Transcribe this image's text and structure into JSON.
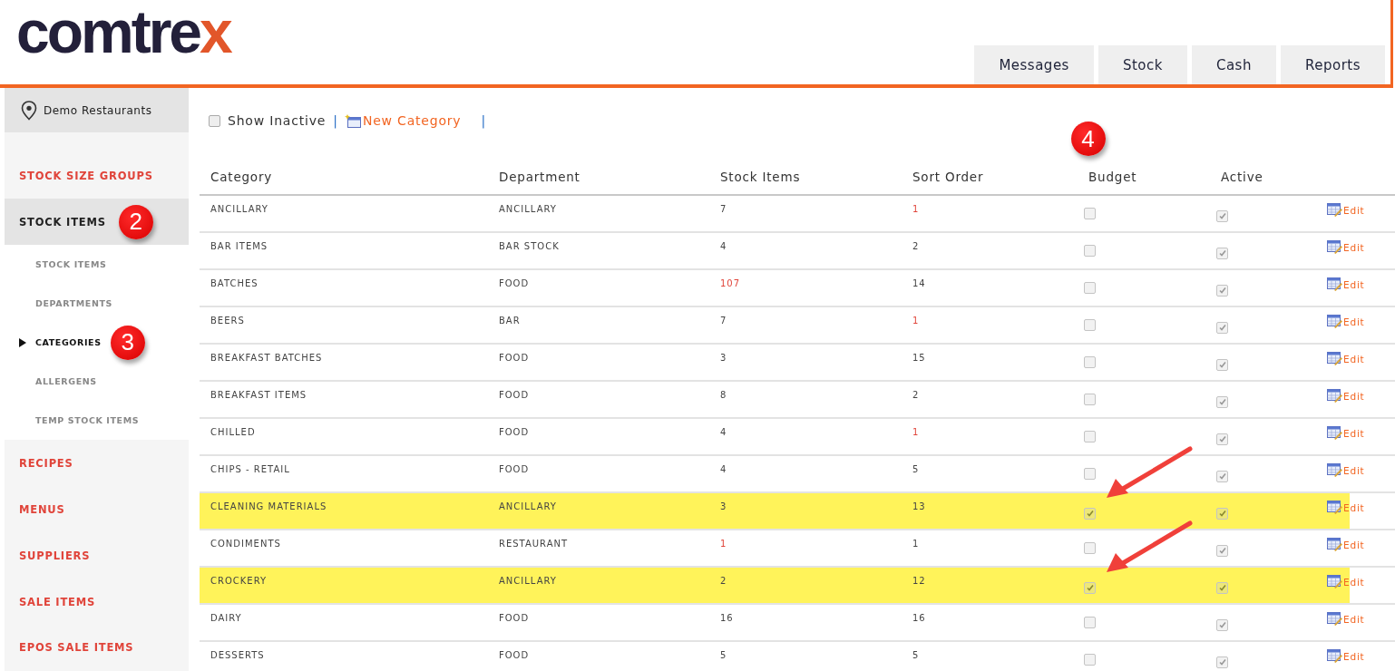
{
  "logo": {
    "text": "comtre",
    "accent": "x"
  },
  "nav_tabs": [
    {
      "label": "Messages",
      "selected": false
    },
    {
      "label": "Stock",
      "selected": false
    },
    {
      "label": "Cash",
      "selected": false
    },
    {
      "label": "Reports",
      "selected": false
    }
  ],
  "location": "Demo Restaurants",
  "sidebar": {
    "items": [
      {
        "label": "STOCK SIZE GROUPS",
        "selected": false
      },
      {
        "label": "STOCK ITEMS",
        "selected": true,
        "badge": "2",
        "children": [
          {
            "label": "STOCK ITEMS",
            "selected": false
          },
          {
            "label": "DEPARTMENTS",
            "selected": false
          },
          {
            "label": "CATEGORIES",
            "selected": true,
            "badge": "3"
          },
          {
            "label": "ALLERGENS",
            "selected": false
          },
          {
            "label": "TEMP STOCK ITEMS",
            "selected": false
          }
        ]
      },
      {
        "label": "RECIPES",
        "selected": false
      },
      {
        "label": "MENUS",
        "selected": false
      },
      {
        "label": "SUPPLIERS",
        "selected": false
      },
      {
        "label": "SALE ITEMS",
        "selected": false
      },
      {
        "label": "EPOS SALE ITEMS",
        "selected": false
      }
    ]
  },
  "toolbar": {
    "show_inactive": {
      "label": "Show Inactive",
      "checked": false
    },
    "separator": "|",
    "new_button": "New Category",
    "separator_2": "|"
  },
  "table": {
    "columns": [
      {
        "label": "Category"
      },
      {
        "label": "Department"
      },
      {
        "label": "Stock Items"
      },
      {
        "label": "Sort Order"
      },
      {
        "label": "Budget",
        "badge": "4"
      },
      {
        "label": "Active"
      }
    ],
    "rows": [
      {
        "category": "ANCILLARY",
        "department": "ANCILLARY",
        "stock_items": {
          "text": "7",
          "link": false
        },
        "sort_order": {
          "text": "1",
          "link": true
        },
        "budget": false,
        "active": true,
        "highlighted": false,
        "arrow": false,
        "edit": "Edit"
      },
      {
        "category": "BAR ITEMS",
        "department": "BAR STOCK",
        "stock_items": {
          "text": "4",
          "link": false
        },
        "sort_order": {
          "text": "2",
          "link": false
        },
        "budget": false,
        "active": true,
        "highlighted": false,
        "arrow": false,
        "edit": "Edit"
      },
      {
        "category": "BATCHES",
        "department": "FOOD",
        "stock_items": {
          "text": "107",
          "link": true
        },
        "sort_order": {
          "text": "14",
          "link": false
        },
        "budget": false,
        "active": true,
        "highlighted": false,
        "arrow": false,
        "edit": "Edit"
      },
      {
        "category": "BEERS",
        "department": "BAR",
        "stock_items": {
          "text": "7",
          "link": false
        },
        "sort_order": {
          "text": "1",
          "link": true
        },
        "budget": false,
        "active": true,
        "highlighted": false,
        "arrow": false,
        "edit": "Edit"
      },
      {
        "category": "BREAKFAST BATCHES",
        "department": "FOOD",
        "stock_items": {
          "text": "3",
          "link": false
        },
        "sort_order": {
          "text": "15",
          "link": false
        },
        "budget": false,
        "active": true,
        "highlighted": false,
        "arrow": false,
        "edit": "Edit"
      },
      {
        "category": "BREAKFAST ITEMS",
        "department": "FOOD",
        "stock_items": {
          "text": "8",
          "link": false
        },
        "sort_order": {
          "text": "2",
          "link": false
        },
        "budget": false,
        "active": true,
        "highlighted": false,
        "arrow": false,
        "edit": "Edit"
      },
      {
        "category": "CHILLED",
        "department": "FOOD",
        "stock_items": {
          "text": "4",
          "link": false
        },
        "sort_order": {
          "text": "1",
          "link": true
        },
        "budget": false,
        "active": true,
        "highlighted": false,
        "arrow": false,
        "edit": "Edit"
      },
      {
        "category": "CHIPS - RETAIL",
        "department": "FOOD",
        "stock_items": {
          "text": "4",
          "link": false
        },
        "sort_order": {
          "text": "5",
          "link": false
        },
        "budget": false,
        "active": true,
        "highlighted": false,
        "arrow": false,
        "edit": "Edit"
      },
      {
        "category": "CLEANING MATERIALS",
        "department": "ANCILLARY",
        "stock_items": {
          "text": "3",
          "link": false
        },
        "sort_order": {
          "text": "13",
          "link": false
        },
        "budget": true,
        "active": true,
        "highlighted": true,
        "arrow": true,
        "edit": "Edit"
      },
      {
        "category": "CONDIMENTS",
        "department": "RESTAURANT",
        "stock_items": {
          "text": "1",
          "link": true
        },
        "sort_order": {
          "text": "1",
          "link": false
        },
        "budget": false,
        "active": true,
        "highlighted": false,
        "arrow": false,
        "edit": "Edit"
      },
      {
        "category": "CROCKERY",
        "department": "ANCILLARY",
        "stock_items": {
          "text": "2",
          "link": false
        },
        "sort_order": {
          "text": "12",
          "link": false
        },
        "budget": true,
        "active": true,
        "highlighted": true,
        "arrow": true,
        "edit": "Edit"
      },
      {
        "category": "DAIRY",
        "department": "FOOD",
        "stock_items": {
          "text": "16",
          "link": false
        },
        "sort_order": {
          "text": "16",
          "link": false
        },
        "budget": false,
        "active": true,
        "highlighted": false,
        "arrow": false,
        "edit": "Edit"
      },
      {
        "category": "DESSERTS",
        "department": "FOOD",
        "stock_items": {
          "text": "5",
          "link": false
        },
        "sort_order": {
          "text": "5",
          "link": false
        },
        "budget": false,
        "active": true,
        "highlighted": false,
        "arrow": false,
        "edit": "Edit"
      }
    ]
  }
}
